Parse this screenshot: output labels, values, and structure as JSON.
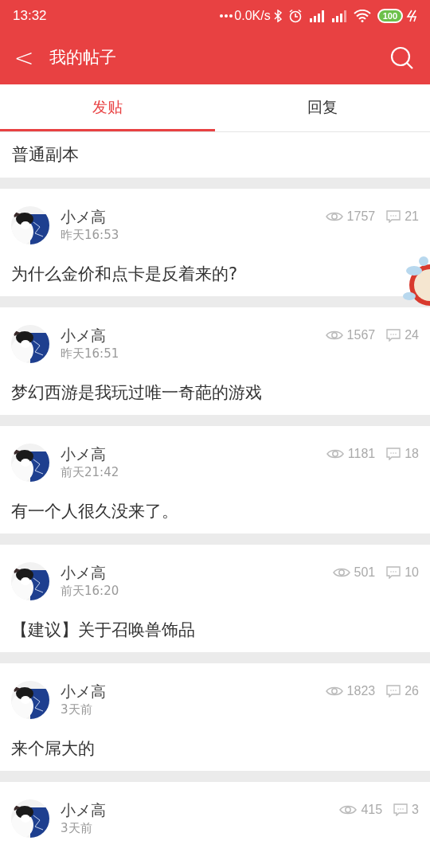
{
  "status_bar": {
    "time": "13:32",
    "network_speed": "0.0K/s",
    "battery": "100"
  },
  "header": {
    "back": "<",
    "title": "我的帖子"
  },
  "tabs": [
    {
      "label": "发贴",
      "selected": true
    },
    {
      "label": "回复",
      "selected": false
    }
  ],
  "partial_post": {
    "title": "普通副本"
  },
  "posts": [
    {
      "author": "小メ高",
      "time": "昨天16:53",
      "views": "1757",
      "comments": "21",
      "title": "为什么金价和点卡是反着来的?"
    },
    {
      "author": "小メ高",
      "time": "昨天16:51",
      "views": "1567",
      "comments": "24",
      "title": "梦幻西游是我玩过唯一奇葩的游戏"
    },
    {
      "author": "小メ高",
      "time": "前天21:42",
      "views": "1181",
      "comments": "18",
      "title": "有一个人很久没来了。"
    },
    {
      "author": "小メ高",
      "time": "前天16:20",
      "views": "501",
      "comments": "10",
      "title": "【建议】关于召唤兽饰品"
    },
    {
      "author": "小メ高",
      "time": "3天前",
      "views": "1823",
      "comments": "26",
      "title": "来个屌大的"
    },
    {
      "author": "小メ高",
      "time": "3天前",
      "views": "415",
      "comments": "3"
    }
  ]
}
